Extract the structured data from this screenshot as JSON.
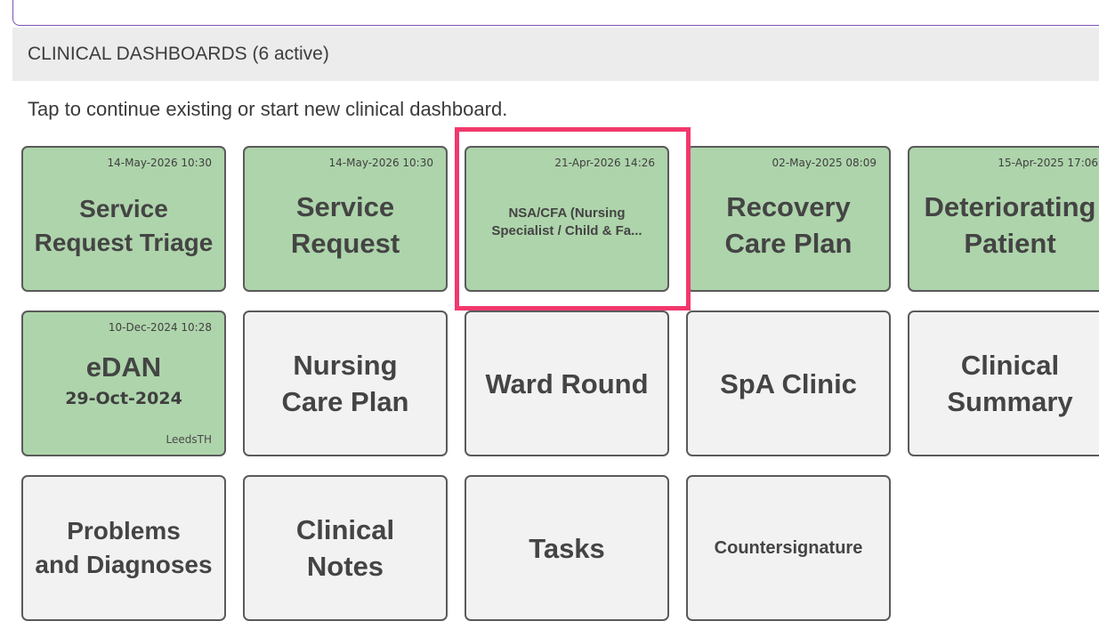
{
  "header": {
    "section_title": "CLINICAL DASHBOARDS (6 active)",
    "instruction": "Tap to continue existing or start new clinical dashboard."
  },
  "tiles": [
    {
      "title": "Service\nRequest Triage",
      "timestamp": "14-May-2026 10:30",
      "active": true
    },
    {
      "title": "Service\nRequest",
      "timestamp": "14-May-2026 10:30",
      "active": true
    },
    {
      "title": "NSA/CFA (Nursing\nSpecialist / Child & Fa...",
      "timestamp": "21-Apr-2026 14:26",
      "active": true,
      "highlighted": true
    },
    {
      "title": "Recovery\nCare Plan",
      "timestamp": "02-May-2025 08:09",
      "active": true
    },
    {
      "title": "Deteriorating\nPatient",
      "timestamp": "15-Apr-2025 17:06",
      "active": true
    },
    {
      "title": "eDAN",
      "timestamp": "10-Dec-2024 10:28",
      "subtitle": "29-Oct-2024",
      "organisation": "LeedsTH",
      "active": true
    },
    {
      "title": "Nursing\nCare Plan",
      "active": false
    },
    {
      "title": "Ward Round",
      "active": false
    },
    {
      "title": "SpA Clinic",
      "active": false
    },
    {
      "title": "Clinical\nSummary",
      "active": false
    },
    {
      "title": "Problems\nand Diagnoses",
      "active": false
    },
    {
      "title": "Clinical\nNotes",
      "active": false
    },
    {
      "title": "Tasks",
      "active": false
    },
    {
      "title": "Countersignature",
      "active": false
    }
  ],
  "colors": {
    "active_tile": "#aed4ab",
    "inactive_tile": "#f2f2f2",
    "highlight_border": "#f2386c",
    "top_card_border": "#7a52b3"
  }
}
